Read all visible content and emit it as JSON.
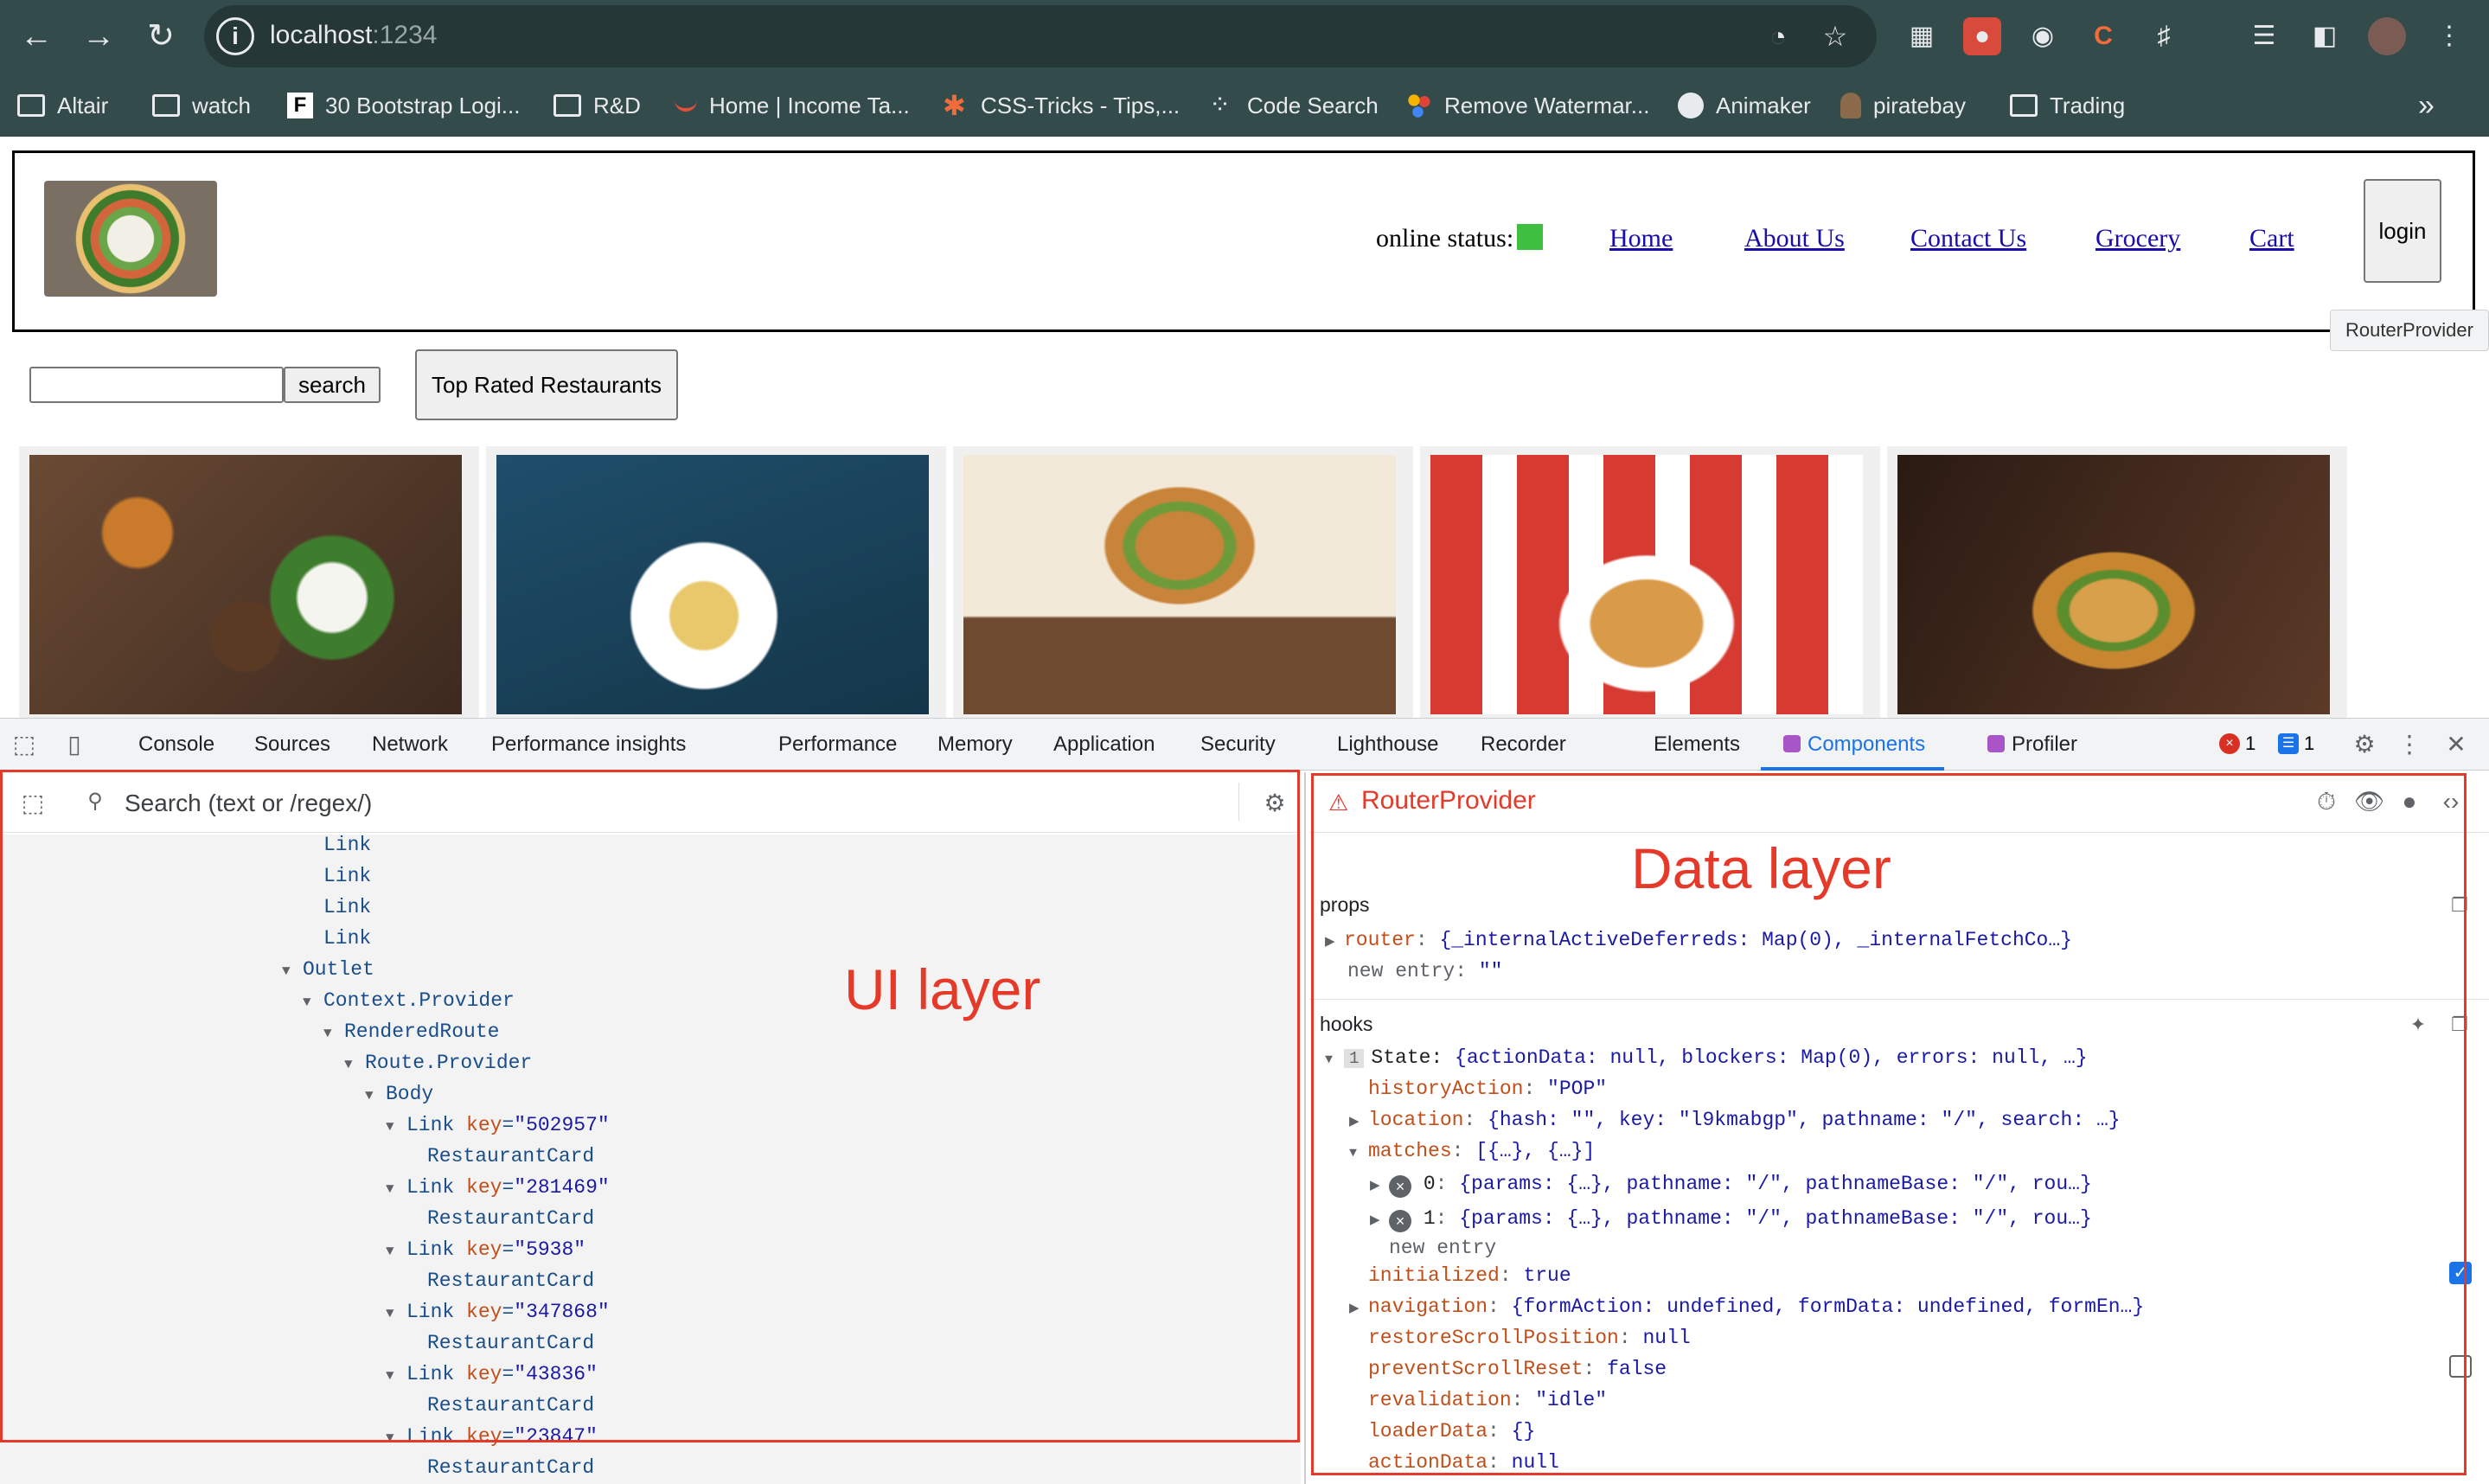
{
  "browser": {
    "url_host": "localhost",
    "url_port": ":1234",
    "bookmarks": [
      {
        "label": "Altair"
      },
      {
        "label": "watch"
      },
      {
        "label": "30 Bootstrap Logi..."
      },
      {
        "label": "R&D"
      },
      {
        "label": "Home | Income Ta..."
      },
      {
        "label": "CSS-Tricks - Tips,..."
      },
      {
        "label": "Code Search"
      },
      {
        "label": "Remove Watermar..."
      },
      {
        "label": "Animaker"
      },
      {
        "label": "piratebay"
      },
      {
        "label": "Trading"
      }
    ],
    "overflow": "»"
  },
  "page": {
    "online_status_label": "online status:",
    "nav": [
      "Home",
      "About Us",
      "Contact Us",
      "Grocery",
      "Cart"
    ],
    "login_label": "login",
    "tooltip": "RouterProvider",
    "search_label": "search",
    "search_value": "",
    "top_rated_label": "Top Rated Restaurants"
  },
  "devtools": {
    "tabs": [
      "Console",
      "Sources",
      "Network",
      "Performance insights",
      "Performance",
      "Memory",
      "Application",
      "Security",
      "Lighthouse",
      "Recorder",
      "Elements",
      "Components",
      "Profiler"
    ],
    "active_tab": "Components",
    "error_count": "1",
    "message_count": "1",
    "search_placeholder": "Search (text or /regex/)",
    "tree": [
      {
        "label": "Link"
      },
      {
        "label": "Link"
      },
      {
        "label": "Link"
      },
      {
        "label": "Link"
      },
      {
        "label": "Outlet"
      },
      {
        "label": "Context.Provider"
      },
      {
        "label": "RenderedRoute"
      },
      {
        "label": "Route.Provider"
      },
      {
        "label": "Body"
      },
      {
        "label": "Link",
        "key": "key",
        "val": "\"502957\""
      },
      {
        "label": "RestaurantCard"
      },
      {
        "label": "Link",
        "key": "key",
        "val": "\"281469\""
      },
      {
        "label": "RestaurantCard"
      },
      {
        "label": "Link",
        "key": "key",
        "val": "\"5938\""
      },
      {
        "label": "RestaurantCard"
      },
      {
        "label": "Link",
        "key": "key",
        "val": "\"347868\""
      },
      {
        "label": "RestaurantCard"
      },
      {
        "label": "Link",
        "key": "key",
        "val": "\"43836\""
      },
      {
        "label": "RestaurantCard"
      },
      {
        "label": "Link",
        "key": "key",
        "val": "\"23847\""
      },
      {
        "label": "RestaurantCard"
      }
    ],
    "selected_component": "RouterProvider",
    "props_title": "props",
    "props": {
      "router_name": "router",
      "router_value": "{_internalActiveDeferreds: Map(0), _internalFetchCo…}",
      "new_entry_label": "new entry:",
      "new_entry_value": "\"\""
    },
    "hooks_title": "hooks",
    "hooks": {
      "state_index": "1",
      "state_label": "State:",
      "state_value": "{actionData: null, blockers: Map(0), errors: null, …}",
      "entries": [
        {
          "name": "historyAction",
          "value": "\"POP\""
        },
        {
          "name": "location",
          "value": "{hash: \"\", key: \"l9kmabgp\", pathname: \"/\", search: …}"
        },
        {
          "name": "matches",
          "value": "[{…}, {…}]"
        },
        {
          "name": "0",
          "value": "{params: {…}, pathname: \"/\", pathnameBase: \"/\", rou…}"
        },
        {
          "name": "1",
          "value": "{params: {…}, pathname: \"/\", pathnameBase: \"/\", rou…}"
        },
        {
          "name": "new entry",
          "value": ""
        },
        {
          "name": "initialized",
          "value": "true"
        },
        {
          "name": "navigation",
          "value": "{formAction: undefined, formData: undefined, formEn…}"
        },
        {
          "name": "restoreScrollPosition",
          "value": "null"
        },
        {
          "name": "preventScrollReset",
          "value": "false"
        },
        {
          "name": "revalidation",
          "value": "\"idle\""
        },
        {
          "name": "loaderData",
          "value": "{}"
        },
        {
          "name": "actionData",
          "value": "null"
        }
      ]
    }
  },
  "annotations": {
    "ui_layer": "UI layer",
    "data_layer": "Data layer"
  },
  "colors": {
    "chrome": "#344b4c",
    "annotation": "#e53a2a",
    "link": "#1a0dab",
    "devtools_accent": "#1a73e8"
  }
}
